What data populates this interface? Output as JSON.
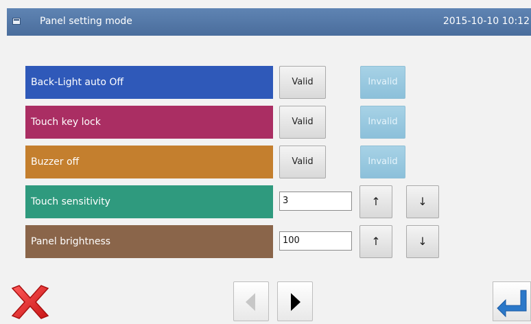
{
  "header": {
    "title": "Panel setting mode",
    "datetime": "2015-10-10 10:12"
  },
  "rows": [
    {
      "label": "Back-Light auto Off",
      "color": "#2f59b9",
      "valid_label": "Valid",
      "invalid_label": "Invalid"
    },
    {
      "label": "Touch key lock",
      "color": "#aa2e63",
      "valid_label": "Valid",
      "invalid_label": "Invalid"
    },
    {
      "label": "Buzzer off",
      "color": "#c47f2e",
      "valid_label": "Valid",
      "invalid_label": "Invalid"
    },
    {
      "label": "Touch sensitivity",
      "color": "#2f9a7e",
      "value": "3",
      "up_symbol": "↑",
      "down_symbol": "↓"
    },
    {
      "label": "Panel brightness",
      "color": "#8a654a",
      "value": "100",
      "up_symbol": "↑",
      "down_symbol": "↓"
    }
  ],
  "footer": {
    "cancel_icon": "red-x-icon",
    "prev_icon": "triangle-left-icon",
    "next_icon": "triangle-right-icon",
    "enter_icon": "enter-return-icon"
  }
}
